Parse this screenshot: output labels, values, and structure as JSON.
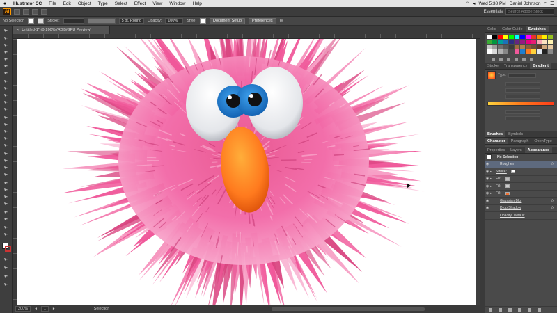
{
  "menubar": {
    "app_name": "Illustrator CC",
    "menus": [
      "File",
      "Edit",
      "Object",
      "Type",
      "Select",
      "Effect",
      "View",
      "Window",
      "Help"
    ],
    "clock": "Wed 5:38 PM",
    "user": "Daniel Johnson"
  },
  "appbar": {
    "logo": "Ai",
    "workspace": "Essentials",
    "search_placeholder": "Search Adobe Stock"
  },
  "control": {
    "selection": "No Selection",
    "stroke_label": "Stroke:",
    "brush": "5 pt. Round",
    "opacity_label": "Opacity:",
    "opacity_value": "100%",
    "style_label": "Style:",
    "doc_setup": "Document Setup",
    "preferences": "Preferences"
  },
  "document": {
    "tab_title": "Untitled-1* @ 200% (RGB/GPU Preview)"
  },
  "status": {
    "zoom": "200%",
    "artboard": "1",
    "mode": "Selection"
  },
  "colors": {
    "fur": "#f0589a",
    "iris": "#1f7fd0",
    "nose": "#ff7a1e"
  },
  "panels": {
    "color_tabs": [
      "Color",
      "Color Guide",
      "Swatches"
    ],
    "gradient_tabs": [
      "Stroke",
      "Transparency",
      "Gradient"
    ],
    "gradient_type_label": "Type:",
    "brush_tabs": [
      "Brushes",
      "Symbols"
    ],
    "char_tabs": [
      "Character",
      "Paragraph",
      "OpenType"
    ],
    "appearance_tabs": [
      "Properties",
      "Layers",
      "Appearance"
    ],
    "appearance": {
      "header": "No Selection",
      "rows": [
        "Roughen",
        "Stroke:",
        "Fill:",
        "Fill:",
        "Fill:",
        "Gaussian Blur",
        "Drop Shadow",
        "Opacity: Default"
      ]
    }
  }
}
